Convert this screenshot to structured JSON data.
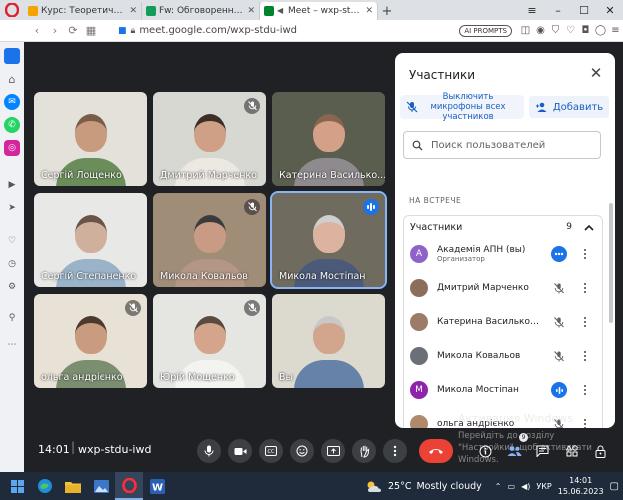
{
  "browser": {
    "tabs": [
      {
        "label": "Курс: Теоретичні основи",
        "color": "#f6a300",
        "active": false
      },
      {
        "label": "Fw: Обговорення • olexa",
        "color": "#0f9d58",
        "active": false
      },
      {
        "label": "Meet – wxp-stdu-iwd",
        "color": "#00832d",
        "active": true
      }
    ],
    "url": "meet.google.com/wxp-stdu-iwd",
    "ai_badge": "AI PROMPTS"
  },
  "tiles": [
    {
      "name": "Сергій Лощенко",
      "muted": false,
      "speaking": false,
      "bg": "#e4e1da",
      "skin": "#c89a7e",
      "shirt": "#6a8d5a",
      "hair": "#7a5d48"
    },
    {
      "name": "Дмитрий Марченко",
      "muted": true,
      "speaking": false,
      "bg": "#d8d8d2",
      "skin": "#d0a086",
      "shirt": "#ece9e2",
      "hair": "#3d2e27"
    },
    {
      "name": "Катерина Василько...",
      "muted": false,
      "speaking": false,
      "bg": "#5a5e4e",
      "skin": "#d4a088",
      "shirt": "#8e8a8e",
      "hair": "#8a6650"
    },
    {
      "name": "Сергій Степаненко",
      "muted": false,
      "speaking": false,
      "bg": "#e8e9e6",
      "skin": "#cfb09c",
      "shirt": "#9ab3c9",
      "hair": "#6a5446"
    },
    {
      "name": "Микола Ковальов",
      "muted": true,
      "speaking": false,
      "bg": "#a08d78",
      "skin": "#c99a84",
      "shirt": "#b39684",
      "hair": "#3b3b3b"
    },
    {
      "name": "Микола Мостіпан",
      "muted": false,
      "speaking": true,
      "bg": "#6f6b5f",
      "skin": "#dcb39e",
      "shirt": "#4a5a78",
      "hair": "#cfcfcf"
    },
    {
      "name": "ольга андрієнко",
      "muted": true,
      "speaking": false,
      "bg": "#e8e2d6",
      "skin": "#c99c80",
      "shirt": "#7b8e70",
      "hair": "#4d3a2e"
    },
    {
      "name": "Юрій Мощенко",
      "muted": true,
      "speaking": false,
      "bg": "#e5e6e2",
      "skin": "#d5a48c",
      "shirt": "#f3f3f0",
      "hair": "#5a4a40"
    },
    {
      "name": "Вы",
      "muted": false,
      "speaking": false,
      "bg": "#dcd9cf",
      "skin": "#d2a68c",
      "shirt": "#6682a8",
      "hair": "#c8c8c8"
    }
  ],
  "panel": {
    "title": "Участники",
    "mute_all": "Выключить микрофоны всех участников",
    "add": "Добавить",
    "search_placeholder": "Поиск пользователей",
    "section": "НА ВСТРЕЧЕ",
    "group_label": "Участники",
    "group_count": "9",
    "participants": [
      {
        "name": "Академія АПН (вы)",
        "role": "Организатор",
        "avatar": "A",
        "avatar_color": "#8e63c9",
        "mic": "talking"
      },
      {
        "name": "Дмитрий Марченко",
        "role": "",
        "avatar": "",
        "avatar_color": "#8d6e5c",
        "mic": "off"
      },
      {
        "name": "Катерина Васильковс...",
        "role": "",
        "avatar": "",
        "avatar_color": "#9c7c68",
        "mic": "off"
      },
      {
        "name": "Микола Ковальов",
        "role": "",
        "avatar": "",
        "avatar_color": "#6a6f78",
        "mic": "off"
      },
      {
        "name": "Микола Мостіпан",
        "role": "",
        "avatar": "M",
        "avatar_color": "#8e24aa",
        "mic": "speaking"
      },
      {
        "name": "ольга андрієнко",
        "role": "",
        "avatar": "",
        "avatar_color": "#b08a6a",
        "mic": "off"
      }
    ]
  },
  "bottom": {
    "time": "14:01",
    "separator": "|",
    "code": "wxp-stdu-iwd",
    "participants_count": "9"
  },
  "watermark": {
    "title": "Активация Windows",
    "text": "Перейдіть до розділу \"Настройки\", щоб активувати Windows."
  },
  "taskbar": {
    "temp": "25°C",
    "weather": "Mostly cloudy",
    "lang": "УКР",
    "time": "14:01",
    "date": "15.06.2023"
  }
}
